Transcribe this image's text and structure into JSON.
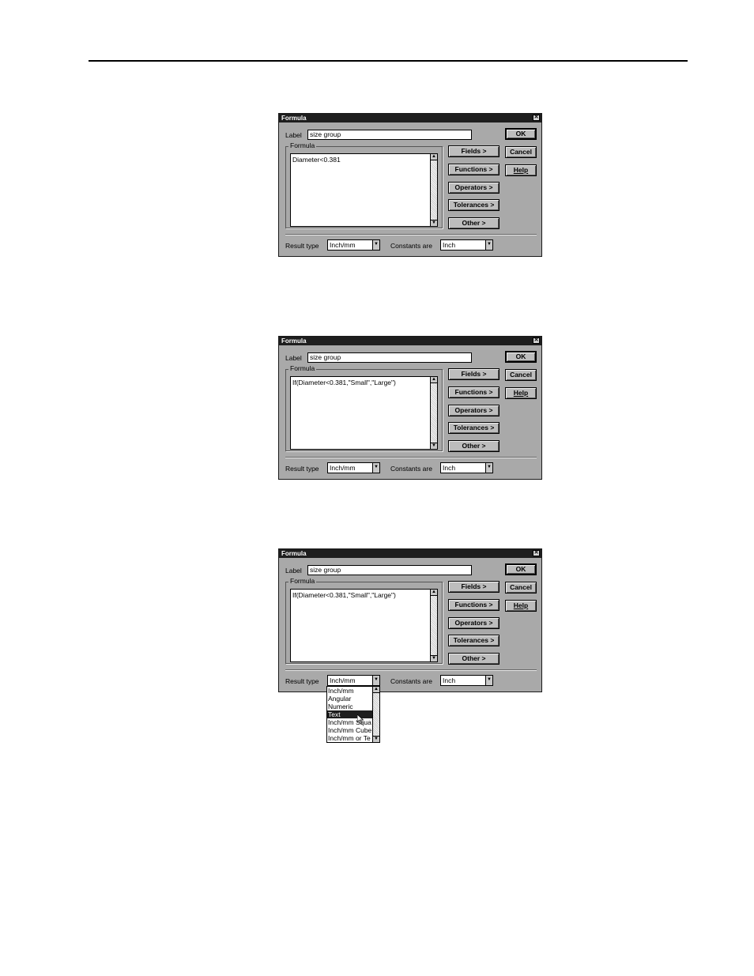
{
  "dialogs": [
    {
      "title": "Formula",
      "label_caption": "Label",
      "label_value": "size group",
      "formula_caption": "Formula",
      "formula_text": "Diameter<0.381",
      "buttons": {
        "fields": "Fields >",
        "functions": "Functions >",
        "operators": "Operators >",
        "tolerances": "Tolerances >",
        "other": "Other >",
        "ok": "OK",
        "cancel": "Cancel",
        "help": "Help"
      },
      "result_type_caption": "Result type",
      "result_type_value": "Inch/mm",
      "constants_caption": "Constants are",
      "constants_value": "Inch"
    },
    {
      "title": "Formula",
      "label_caption": "Label",
      "label_value": "size group",
      "formula_caption": "Formula",
      "formula_text": "If(Diameter<0.381,\"Small\",\"Large\")",
      "buttons": {
        "fields": "Fields >",
        "functions": "Functions >",
        "operators": "Operators >",
        "tolerances": "Tolerances >",
        "other": "Other >",
        "ok": "OK",
        "cancel": "Cancel",
        "help": "Help"
      },
      "result_type_caption": "Result type",
      "result_type_value": "Inch/mm",
      "constants_caption": "Constants are",
      "constants_value": "Inch"
    },
    {
      "title": "Formula",
      "label_caption": "Label",
      "label_value": "size group",
      "formula_caption": "Formula",
      "formula_text": "If(Diameter<0.381,\"Small\",\"Large\")",
      "buttons": {
        "fields": "Fields >",
        "functions": "Functions >",
        "operators": "Operators >",
        "tolerances": "Tolerances >",
        "other": "Other >",
        "ok": "OK",
        "cancel": "Cancel",
        "help": "Help"
      },
      "result_type_caption": "Result type",
      "result_type_value": "Inch/mm",
      "constants_caption": "Constants are",
      "constants_value": "Inch"
    }
  ],
  "dropdown": {
    "options": [
      "Inch/mm",
      "Angular",
      "Numeric",
      "Text",
      "Inch/mm Squa",
      "Inch/mm Cube",
      "Inch/mm or Te"
    ],
    "selected": "Text"
  },
  "icons": {
    "close": "close-icon",
    "scroll_up": "scroll-up-arrow-icon",
    "scroll_down": "scroll-down-arrow-icon",
    "dropdown": "chevron-down-icon",
    "cursor": "mouse-pointer-icon"
  },
  "colors": {
    "dialog_face": "#a9a9a9",
    "title_bar": "#1e1e1e",
    "selection": "#1e1e1e"
  }
}
